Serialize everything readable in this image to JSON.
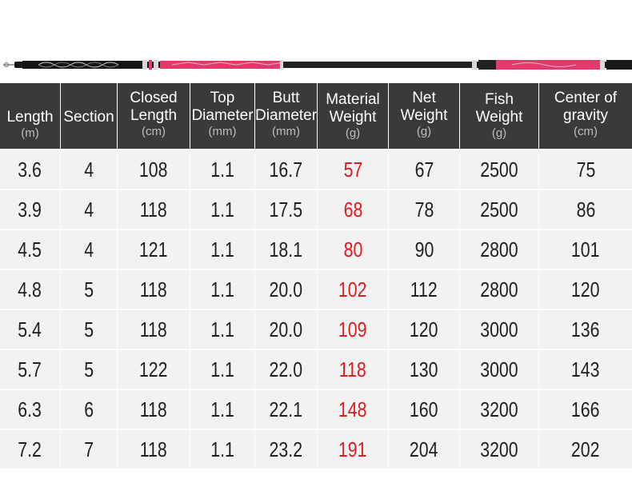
{
  "colors": {
    "header_bg": "#3a3a3a",
    "row_bg": "#f2f2f2",
    "highlight_red": "#e0191b",
    "rod_pink": "#e23a6a",
    "rod_black": "#1a1a1a"
  },
  "header": {
    "length": {
      "label": "Length",
      "unit": "(m)"
    },
    "section": {
      "label": "Section",
      "unit": ""
    },
    "closed_length": {
      "label": "Closed\nLength",
      "unit": "(cm)"
    },
    "top_diameter": {
      "label": "Top\nDiameter",
      "unit": "(mm)"
    },
    "butt_diameter": {
      "label": "Butt\nDiameter",
      "unit": "(mm)"
    },
    "material_weight": {
      "label": "Material\nWeight",
      "unit": "(g)"
    },
    "net_weight": {
      "label": "Net\nWeight",
      "unit": "(g)"
    },
    "fish_weight": {
      "label": "Fish\nWeight",
      "unit": "(g)"
    },
    "center_of_gravity": {
      "label": "Center of\ngravity",
      "unit": "(cm)"
    }
  },
  "rows": [
    {
      "length": "3.6",
      "section": "4",
      "closed_length": "108",
      "top_diameter": "1.1",
      "butt_diameter": "16.7",
      "material_weight": "57",
      "net_weight": "67",
      "fish_weight": "2500",
      "center_of_gravity": "75"
    },
    {
      "length": "3.9",
      "section": "4",
      "closed_length": "118",
      "top_diameter": "1.1",
      "butt_diameter": "17.5",
      "material_weight": "68",
      "net_weight": "78",
      "fish_weight": "2500",
      "center_of_gravity": "86"
    },
    {
      "length": "4.5",
      "section": "4",
      "closed_length": "121",
      "top_diameter": "1.1",
      "butt_diameter": "18.1",
      "material_weight": "80",
      "net_weight": "90",
      "fish_weight": "2800",
      "center_of_gravity": "101"
    },
    {
      "length": "4.8",
      "section": "5",
      "closed_length": "118",
      "top_diameter": "1.1",
      "butt_diameter": "20.0",
      "material_weight": "102",
      "net_weight": "112",
      "fish_weight": "2800",
      "center_of_gravity": "120"
    },
    {
      "length": "5.4",
      "section": "5",
      "closed_length": "118",
      "top_diameter": "1.1",
      "butt_diameter": "20.0",
      "material_weight": "109",
      "net_weight": "120",
      "fish_weight": "3000",
      "center_of_gravity": "136"
    },
    {
      "length": "5.7",
      "section": "5",
      "closed_length": "122",
      "top_diameter": "1.1",
      "butt_diameter": "22.0",
      "material_weight": "118",
      "net_weight": "130",
      "fish_weight": "3000",
      "center_of_gravity": "143"
    },
    {
      "length": "6.3",
      "section": "6",
      "closed_length": "118",
      "top_diameter": "1.1",
      "butt_diameter": "22.1",
      "material_weight": "148",
      "net_weight": "160",
      "fish_weight": "3200",
      "center_of_gravity": "166"
    },
    {
      "length": "7.2",
      "section": "7",
      "closed_length": "118",
      "top_diameter": "1.1",
      "butt_diameter": "23.2",
      "material_weight": "191",
      "net_weight": "204",
      "fish_weight": "3200",
      "center_of_gravity": "202"
    }
  ]
}
